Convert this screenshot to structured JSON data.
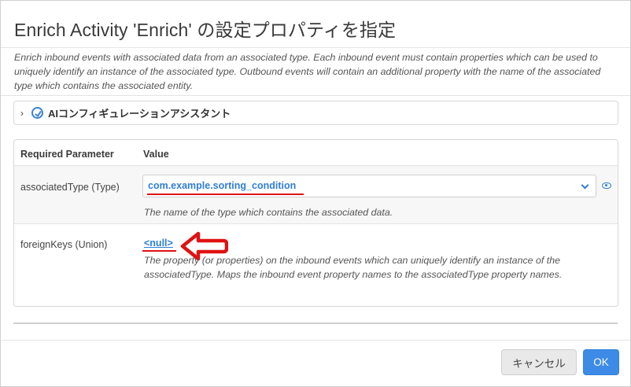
{
  "dialog": {
    "title": "Enrich Activity 'Enrich' の設定プロパティを指定",
    "description": "Enrich inbound events with associated data from an associated type. Each inbound event must contain properties which can be used to uniquely identify an instance of the associated type. Outbound events will contain an additional property with the name of the associated type which contains the associated entity."
  },
  "assistant": {
    "label": "AIコンフィギュレーションアシスタント",
    "icon": "ai-assistant-icon",
    "expanded": false
  },
  "table": {
    "headers": {
      "parameter": "Required Parameter",
      "value": "Value"
    },
    "rows": [
      {
        "name": "associatedType (Type)",
        "value": "com.example.sorting_condition",
        "hint": "The name of the type which contains the associated data."
      },
      {
        "name": "foreignKeys (Union)",
        "value": "<null>",
        "hint": "The property (or properties) on the inbound events which can uniquely identify an instance of the associatedType. Maps the inbound event property names to the associatedType property names."
      }
    ]
  },
  "footer": {
    "cancel_label": "キャンセル",
    "ok_label": "OK"
  },
  "colors": {
    "accent": "#2f7ed8",
    "annotation": "#e01212",
    "ok_button": "#3d8be6"
  }
}
